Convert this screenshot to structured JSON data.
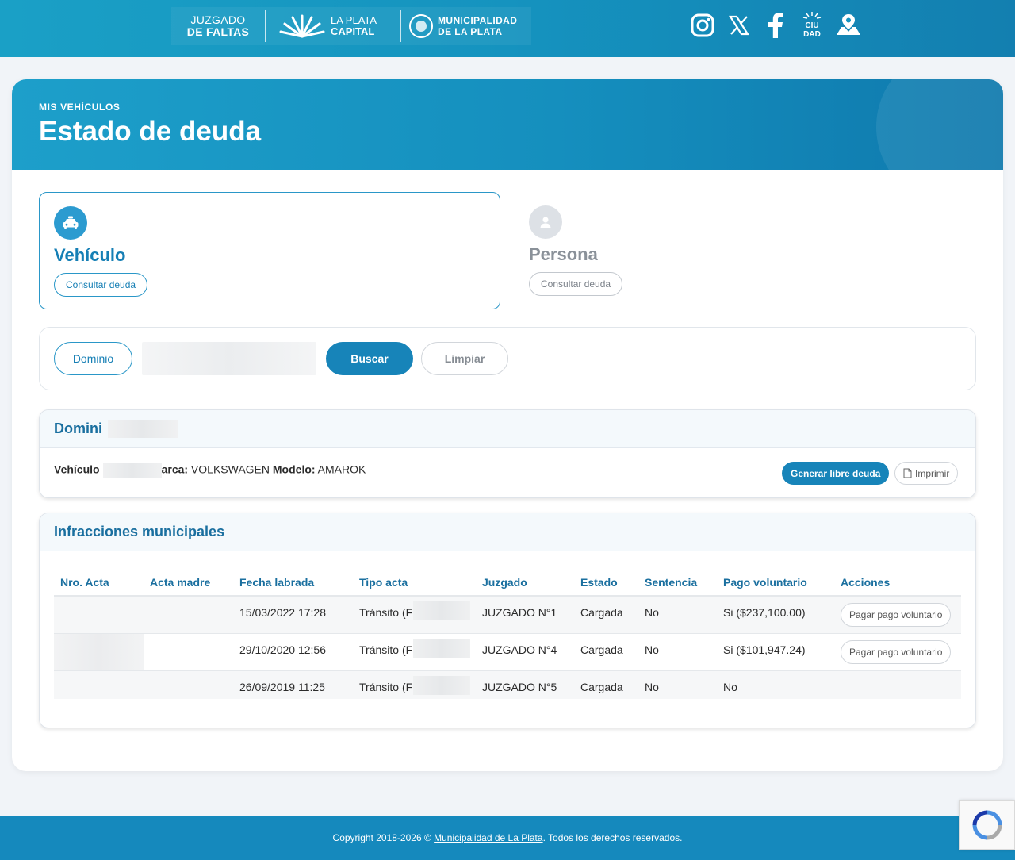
{
  "header": {
    "brand_juzgado_line1": "JUZGADO",
    "brand_juzgado_line2": "DE FALTAS",
    "brand_laplata_line1": "LA PLATA",
    "brand_laplata_line2": "CAPITAL",
    "brand_muni_line1": "MUNICIPALIDAD",
    "brand_muni_line2": "DE LA PLATA",
    "social_icons": [
      "instagram-icon",
      "x-icon",
      "facebook-icon",
      "ciudad-icon",
      "location-icon"
    ]
  },
  "hero": {
    "kicker": "MIS VEHÍCULOS",
    "title": "Estado de deuda"
  },
  "options": {
    "vehiculo": {
      "title": "Vehículo",
      "button": "Consultar deuda"
    },
    "persona": {
      "title": "Persona",
      "button": "Consultar deuda"
    }
  },
  "search": {
    "type_label": "Dominio",
    "input_value": "",
    "buscar_label": "Buscar",
    "limpiar_label": "Limpiar"
  },
  "domain_panel": {
    "title": "Domini",
    "vehicle_label": "Vehículo",
    "marca_label": "arca:",
    "marca_value": " VOLKSWAGEN ",
    "modelo_label": "Modelo:",
    "modelo_value": " AMAROK",
    "generar_label": "Generar libre deuda",
    "imprimir_label": "Imprimir"
  },
  "infracciones": {
    "title": "Infracciones municipales",
    "columns": [
      "Nro. Acta",
      "Acta madre",
      "Fecha labrada",
      "Tipo acta",
      "Juzgado",
      "Estado",
      "Sentencia",
      "Pago voluntario",
      "Acciones"
    ],
    "rows": [
      {
        "fecha": "15/03/2022 17:28",
        "tipo": "Tránsito (F",
        "juzgado": "JUZGADO N°1",
        "estado": "Cargada",
        "sentencia": "No",
        "pago": "Si ($237,100.00)",
        "accion": "Pagar pago voluntario"
      },
      {
        "fecha": "29/10/2020 12:56",
        "tipo": "Tránsito (F",
        "juzgado": "JUZGADO N°4",
        "estado": "Cargada",
        "sentencia": "No",
        "pago": "Si ($101,947.24)",
        "accion": "Pagar pago voluntario"
      },
      {
        "fecha": "26/09/2019 11:25",
        "tipo": "Tránsito (F",
        "juzgado": "JUZGADO N°5",
        "estado": "Cargada",
        "sentencia": "No",
        "pago": "No",
        "accion": ""
      }
    ]
  },
  "footer": {
    "prefix": "Copyright 2018-2026 © ",
    "link": "Municipalidad de La Plata",
    "suffix": ". Todos los derechos reservados."
  },
  "colors": {
    "primary": "#1784b9",
    "header_bg": "#1593bf",
    "accent_text": "#167fb5"
  }
}
